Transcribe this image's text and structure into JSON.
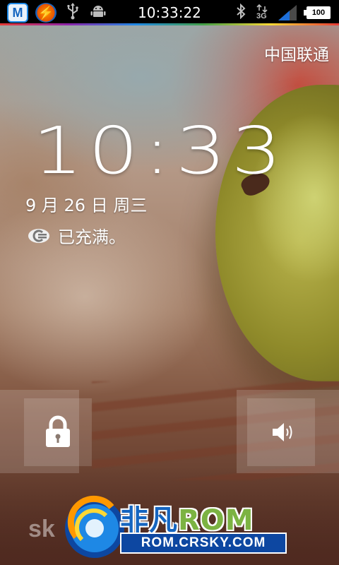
{
  "status_bar": {
    "time": "10:33:22",
    "battery_level": "100",
    "network_type": "3G",
    "icons": [
      "app-m-icon",
      "flash-app-icon",
      "usb-icon",
      "android-debug-icon",
      "bluetooth-icon",
      "data-3g-icon",
      "signal-icon",
      "battery-icon"
    ]
  },
  "lockscreen": {
    "carrier": "中国联通",
    "clock": "10:33",
    "date": "9 月 26 日 周三",
    "charging_status": "已充满。"
  },
  "controls": {
    "lock_icon": "lock-icon",
    "sound_icon": "speaker-icon"
  },
  "watermark": {
    "brand_prefix": "非凡",
    "brand_suffix": "ROM",
    "url": "ROM.CRSKY.COM",
    "side_text": "sk"
  },
  "colors": {
    "statusbar_bg": "#000000",
    "watermark_blue": "#1565c0",
    "watermark_green": "#7cb342"
  }
}
